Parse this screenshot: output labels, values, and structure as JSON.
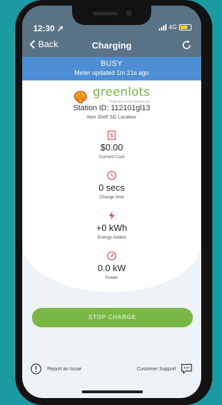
{
  "status_bar": {
    "time": "12:30",
    "network": "4G"
  },
  "nav": {
    "back_label": "Back",
    "title": "Charging"
  },
  "banner": {
    "status": "BUSY",
    "updated": "Meter updated 1m 21s ago"
  },
  "station": {
    "brand": "greenlots",
    "brand_tagline": "A Member of the Shell Group",
    "id_label": "Station ID: 112101gl13",
    "location": "Non Shell SG Location"
  },
  "metrics": [
    {
      "icon": "receipt-icon",
      "value": "$0.00",
      "label": "Current Cost"
    },
    {
      "icon": "clock-icon",
      "value": "0 secs",
      "label": "Charge time"
    },
    {
      "icon": "lightning-icon",
      "value": "+0 kWh",
      "label": "Energy Added"
    },
    {
      "icon": "speedometer-icon",
      "value": "0.0 kW",
      "label": "Power"
    }
  ],
  "actions": {
    "stop_label": "STOP CHARGE"
  },
  "footer": {
    "report_label": "Report an Issue",
    "support_label": "Customer Support"
  },
  "colors": {
    "accent_red": "#e8484e",
    "button_green": "#79b847",
    "banner_blue": "#4d8ed4",
    "header_gray": "#5a7384"
  }
}
